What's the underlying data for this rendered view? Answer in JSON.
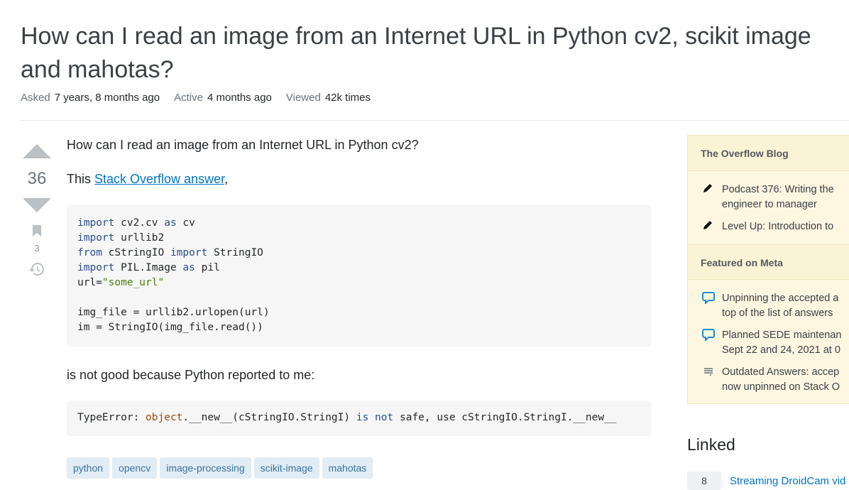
{
  "question": {
    "title": "How can I read an image from an Internet URL in Python cv2, scikit image and mahotas?",
    "meta": {
      "asked_label": "Asked",
      "asked_value": "7 years, 8 months ago",
      "active_label": "Active",
      "active_value": "4 months ago",
      "viewed_label": "Viewed",
      "viewed_value": "42k times"
    },
    "votes": "36",
    "bookmarks": "3",
    "body": {
      "p1": "How can I read an image from an Internet URL in Python cv2?",
      "p2_prefix": "This ",
      "p2_link": "Stack Overflow answer",
      "p2_suffix": ",",
      "code1": [
        [
          {
            "t": "import",
            "c": "kw"
          },
          {
            "t": " cv2.cv "
          },
          {
            "t": "as",
            "c": "kw"
          },
          {
            "t": " cv"
          }
        ],
        [
          {
            "t": "import",
            "c": "kw"
          },
          {
            "t": " urllib2"
          }
        ],
        [
          {
            "t": "from",
            "c": "kw"
          },
          {
            "t": " cStringIO "
          },
          {
            "t": "import",
            "c": "kw"
          },
          {
            "t": " StringIO"
          }
        ],
        [
          {
            "t": "import",
            "c": "kw"
          },
          {
            "t": " PIL.Image "
          },
          {
            "t": "as",
            "c": "kw"
          },
          {
            "t": " pil"
          }
        ],
        [
          {
            "t": "url="
          },
          {
            "t": "\"some_url\"",
            "c": "str"
          }
        ],
        [
          {
            "t": ""
          }
        ],
        [
          {
            "t": "img_file = urllib2.urlopen(url)"
          }
        ],
        [
          {
            "t": "im = StringIO(img_file.read())"
          }
        ]
      ],
      "p3": "is not good because Python reported to me:",
      "code2": [
        [
          {
            "t": "TypeError: "
          },
          {
            "t": "object",
            "c": "err"
          },
          {
            "t": ".__new__(cStringIO.StringI) "
          },
          {
            "t": "is not",
            "c": "kw"
          },
          {
            "t": " safe, use cStringIO.StringI.__new__"
          }
        ]
      ]
    },
    "tags": [
      "python",
      "opencv",
      "image-processing",
      "scikit-image",
      "mahotas"
    ]
  },
  "sidebar": {
    "blog_heading": "The Overflow Blog",
    "blog_items": [
      {
        "icon": "pencil-icon",
        "lines": [
          "Podcast 376: Writing the",
          "engineer to manager"
        ]
      },
      {
        "icon": "pencil-icon",
        "lines": [
          "Level Up: Introduction to"
        ]
      }
    ],
    "meta_heading": "Featured on Meta",
    "meta_items": [
      {
        "icon": "chat-bubble-icon",
        "lines": [
          "Unpinning the accepted a",
          "top of the list of answers"
        ]
      },
      {
        "icon": "chat-bubble-icon",
        "lines": [
          "Planned SEDE maintenan",
          "Sept 22 and 24, 2021 at 0"
        ]
      },
      {
        "icon": "stack-exchange-icon",
        "lines": [
          "Outdated Answers: accep",
          "now unpinned on Stack O"
        ]
      }
    ]
  },
  "linked": {
    "heading": "Linked",
    "items": [
      {
        "count": "8",
        "title": "Streaming DroidCam vid"
      }
    ]
  },
  "colors": {
    "link": "#0074cc",
    "tag_bg": "#e1ecf4",
    "tag_text": "#39739d",
    "sidebar_bg": "#fbf3d5"
  }
}
